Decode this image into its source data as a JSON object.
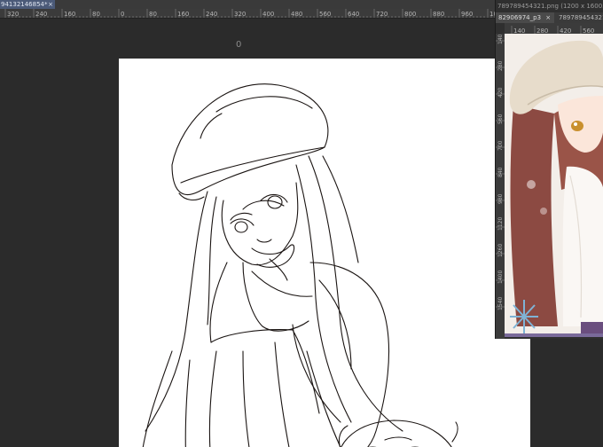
{
  "document_tab": {
    "title": "94132146854*",
    "close_glyph": "×"
  },
  "ruler": {
    "labels": [
      "320",
      "240",
      "160",
      "80",
      "0",
      "80",
      "160",
      "240",
      "320",
      "400",
      "480",
      "560",
      "640",
      "720",
      "800",
      "880",
      "960",
      "1040"
    ]
  },
  "canvas": {
    "center_marker": "0"
  },
  "reference": {
    "title": "789789454321.png (1200 x 1600...",
    "tabs": [
      {
        "label": "82906974_p3",
        "close_glyph": "×"
      },
      {
        "label": "789789454321",
        "close_glyph": ""
      }
    ],
    "hruler_labels": [
      "140",
      "280",
      "420",
      "560"
    ],
    "vruler_labels": [
      "140",
      "280",
      "420",
      "560",
      "700",
      "840",
      "980",
      "1120",
      "1260",
      "1400",
      "1540"
    ]
  },
  "colors": {
    "tab_accent": "#4b5a78",
    "workspace_bg": "#2b2b2b",
    "paper": "#ffffff",
    "line_art": "#1a1412"
  }
}
